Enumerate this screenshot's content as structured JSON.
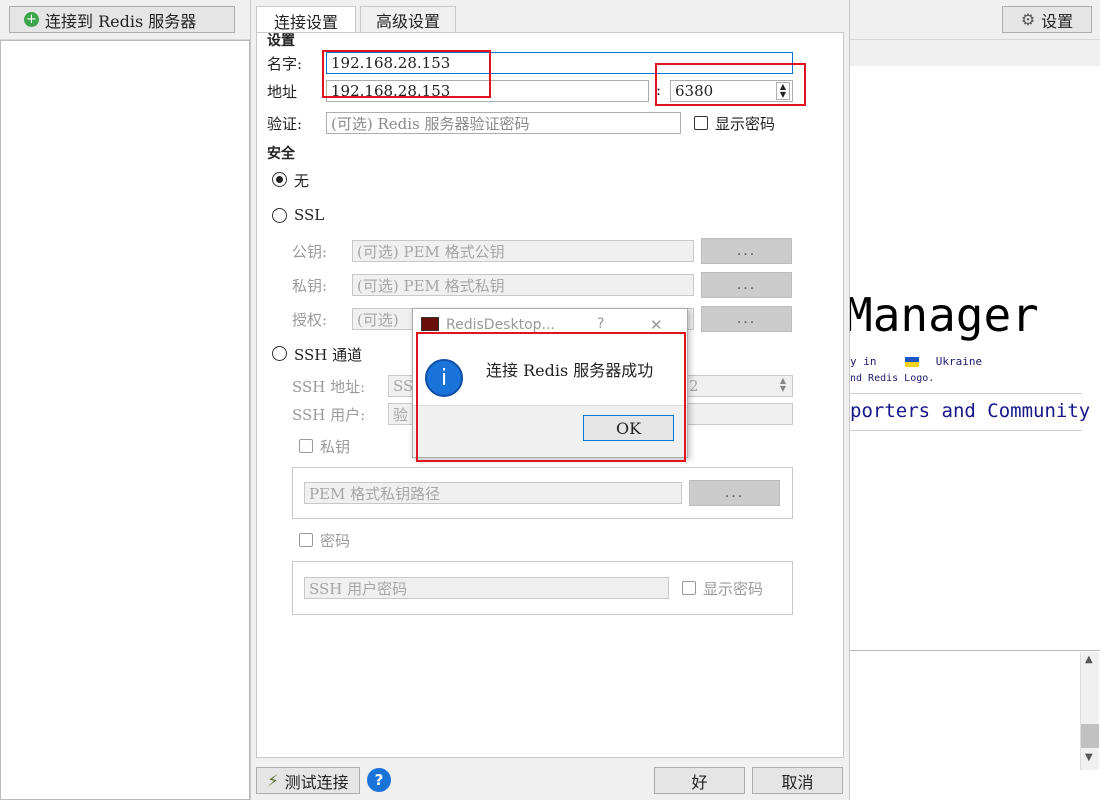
{
  "toolbar": {
    "connect_label": "连接到 Redis 服务器",
    "settings_label": "设置"
  },
  "tabs": {
    "connection": "连接设置",
    "advanced": "高级设置"
  },
  "section_settings": "设置",
  "fields": {
    "name_label": "名字:",
    "name_value": "192.168.28.153",
    "address_label": "地址",
    "address_value": "192.168.28.153",
    "port_sep": ":",
    "port_value": "6380",
    "auth_label": "验证:",
    "auth_placeholder": "(可选) Redis 服务器验证密码",
    "show_password": "显示密码"
  },
  "section_security": "安全",
  "security": {
    "none": "无",
    "ssl": "SSL",
    "public_key_label": "公钥:",
    "public_key_placeholder": "(可选) PEM 格式公钥",
    "private_key_label": "私钥:",
    "private_key_placeholder": "(可选) PEM 格式私钥",
    "authority_label": "授权:",
    "authority_placeholder": "(可选)",
    "browse": "...",
    "ssh_tunnel": "SSH 通道",
    "ssh_address_label": "SSH 地址:",
    "ssh_address_placeholder": "SS",
    "ssh_port_value": "2",
    "ssh_user_label": "SSH 用户:",
    "ssh_user_placeholder": "验",
    "private_key_check": "私钥",
    "pem_path_placeholder": "PEM 格式私钥路径",
    "password_check": "密码",
    "ssh_password_placeholder": "SSH 用户密码",
    "ssh_show_password": "显示密码"
  },
  "footer": {
    "test_connection": "测试连接",
    "help": "?",
    "ok": "好",
    "cancel": "取消"
  },
  "message_box": {
    "title": "RedisDesktop...",
    "help": "?",
    "close": "✕",
    "text": "连接 Redis 服务器成功",
    "ok": "OK"
  },
  "background": {
    "title": "Manager",
    "line1a": "y in",
    "line1b": "Ukraine",
    "line2": "nd Redis Logo.",
    "community": "porters and Community"
  },
  "colors": {
    "accent": "#0078d7",
    "highlight": "#e0141e",
    "info": "#1a73d9"
  }
}
